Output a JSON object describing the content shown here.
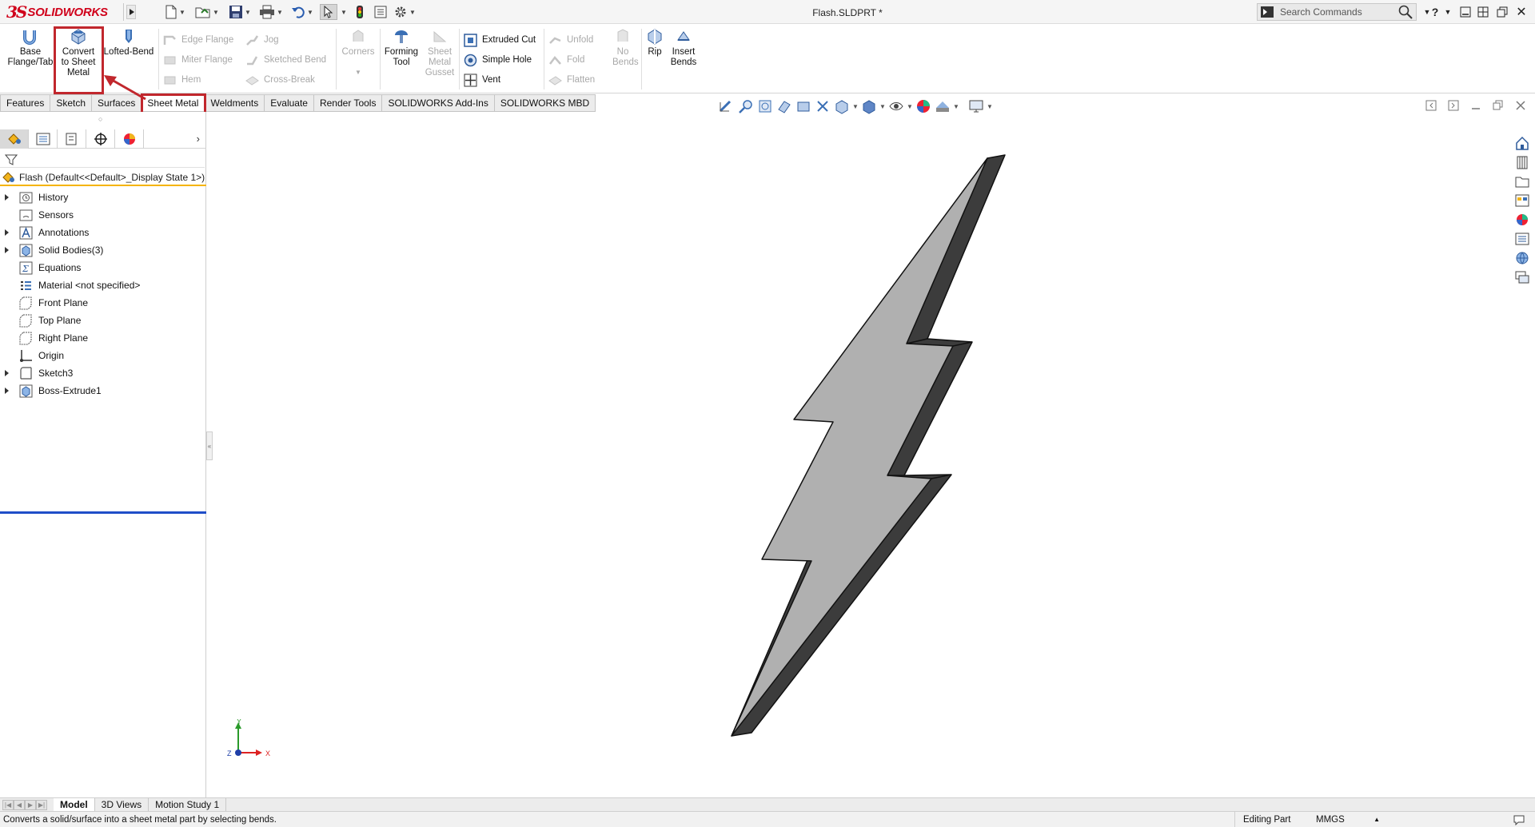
{
  "app": {
    "brand": "SOLIDWORKS",
    "brand_prefix": "3S",
    "document_title": "Flash.SLDPRT *",
    "search_placeholder": "Search Commands"
  },
  "command_manager": {
    "buttons": {
      "base_flange": "Base Flange/Tab",
      "convert": "Convert to Sheet Metal",
      "lofted_bend": "Lofted-Bend",
      "edge_flange": "Edge Flange",
      "miter_flange": "Miter Flange",
      "hem": "Hem",
      "jog": "Jog",
      "sketched_bend": "Sketched Bend",
      "cross_break": "Cross-Break",
      "corners": "Corners",
      "forming_tool": "Forming Tool",
      "sheet_metal_gusset": "Sheet Metal Gusset",
      "extruded_cut": "Extruded Cut",
      "simple_hole": "Simple Hole",
      "vent": "Vent",
      "unfold": "Unfold",
      "fold": "Fold",
      "flatten": "Flatten",
      "no_bends": "No Bends",
      "rip": "Rip",
      "insert_bends": "Insert Bends"
    },
    "tabs": [
      "Features",
      "Sketch",
      "Surfaces",
      "Sheet Metal",
      "Weldments",
      "Evaluate",
      "Render Tools",
      "SOLIDWORKS Add-Ins",
      "SOLIDWORKS MBD"
    ],
    "active_tab": "Sheet Metal"
  },
  "feature_manager": {
    "root": "Flash  (Default<<Default>_Display State 1>)",
    "nodes": [
      {
        "label": "History",
        "icon": "history-folder-icon",
        "expandable": true
      },
      {
        "label": "Sensors",
        "icon": "sensors-folder-icon",
        "expandable": false
      },
      {
        "label": "Annotations",
        "icon": "annotations-icon",
        "expandable": true
      },
      {
        "label": "Solid Bodies(3)",
        "icon": "solid-bodies-icon",
        "expandable": true
      },
      {
        "label": "Equations",
        "icon": "equations-icon",
        "expandable": false
      },
      {
        "label": "Material <not specified>",
        "icon": "material-icon",
        "expandable": false
      },
      {
        "label": "Front Plane",
        "icon": "plane-icon",
        "expandable": false
      },
      {
        "label": "Top Plane",
        "icon": "plane-icon",
        "expandable": false
      },
      {
        "label": "Right Plane",
        "icon": "plane-icon",
        "expandable": false
      },
      {
        "label": "Origin",
        "icon": "origin-icon",
        "expandable": false
      },
      {
        "label": "Sketch3",
        "icon": "sketch-icon",
        "expandable": true
      },
      {
        "label": "Boss-Extrude1",
        "icon": "boss-extrude-icon",
        "expandable": true
      }
    ]
  },
  "graphics": {
    "triad": {
      "x": "X",
      "y": "Y",
      "z": "Z"
    }
  },
  "bottom_tabs": [
    "Model",
    "3D Views",
    "Motion Study 1"
  ],
  "status": {
    "message": "Converts a solid/surface into a sheet metal part by selecting bends.",
    "mode": "Editing Part",
    "units": "MMGS"
  },
  "colors": {
    "brand_red": "#d0021b",
    "highlight_red": "#c1272d",
    "bolt_face": "#b0b0b0",
    "bolt_side": "#3c3c3c",
    "rollback_blue": "#1f4ec8"
  }
}
